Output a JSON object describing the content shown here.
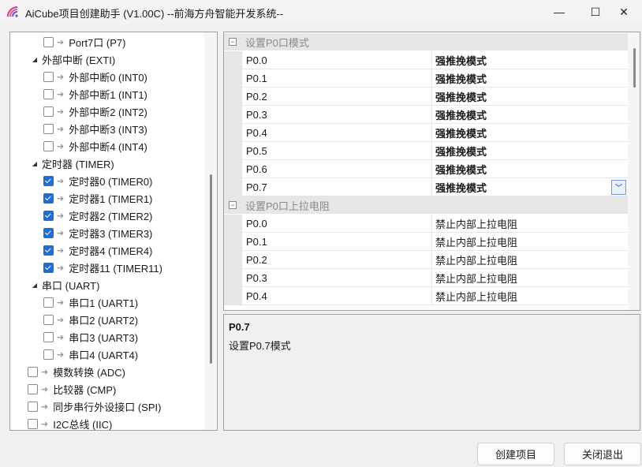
{
  "window": {
    "title": "AiCube项目创建助手 (V1.00C) --前海方舟智能开发系统--",
    "app_icon": "aicube-logo-icon",
    "minimize_glyph": "—",
    "maximize_glyph": "☐",
    "close_glyph": "✕"
  },
  "tree": {
    "items": [
      {
        "label": "Port7口 (P7)",
        "level": 2,
        "checked": false,
        "type": "leaf"
      },
      {
        "label": "外部中断 (EXTI)",
        "level": 1,
        "type": "group",
        "expanded": true
      },
      {
        "label": "外部中断0 (INT0)",
        "level": 2,
        "checked": false,
        "type": "leaf"
      },
      {
        "label": "外部中断1 (INT1)",
        "level": 2,
        "checked": false,
        "type": "leaf"
      },
      {
        "label": "外部中断2 (INT2)",
        "level": 2,
        "checked": false,
        "type": "leaf"
      },
      {
        "label": "外部中断3 (INT3)",
        "level": 2,
        "checked": false,
        "type": "leaf"
      },
      {
        "label": "外部中断4 (INT4)",
        "level": 2,
        "checked": false,
        "type": "leaf"
      },
      {
        "label": "定时器 (TIMER)",
        "level": 1,
        "type": "group",
        "expanded": true
      },
      {
        "label": "定时器0 (TIMER0)",
        "level": 2,
        "checked": true,
        "type": "leaf"
      },
      {
        "label": "定时器1 (TIMER1)",
        "level": 2,
        "checked": true,
        "type": "leaf"
      },
      {
        "label": "定时器2 (TIMER2)",
        "level": 2,
        "checked": true,
        "type": "leaf"
      },
      {
        "label": "定时器3 (TIMER3)",
        "level": 2,
        "checked": true,
        "type": "leaf"
      },
      {
        "label": "定时器4 (TIMER4)",
        "level": 2,
        "checked": true,
        "type": "leaf"
      },
      {
        "label": "定时器11 (TIMER11)",
        "level": 2,
        "checked": true,
        "type": "leaf"
      },
      {
        "label": "串口 (UART)",
        "level": 1,
        "type": "group",
        "expanded": true
      },
      {
        "label": "串口1 (UART1)",
        "level": 2,
        "checked": false,
        "type": "leaf"
      },
      {
        "label": "串口2 (UART2)",
        "level": 2,
        "checked": false,
        "type": "leaf"
      },
      {
        "label": "串口3 (UART3)",
        "level": 2,
        "checked": false,
        "type": "leaf"
      },
      {
        "label": "串口4 (UART4)",
        "level": 2,
        "checked": false,
        "type": "leaf"
      },
      {
        "label": "模数转换 (ADC)",
        "level": 0,
        "checked": false,
        "type": "leaf"
      },
      {
        "label": "比较器 (CMP)",
        "level": 0,
        "checked": false,
        "type": "leaf"
      },
      {
        "label": "同步串行外设接口 (SPI)",
        "level": 0,
        "checked": false,
        "type": "leaf"
      },
      {
        "label": "I2C总线 (IIC)",
        "level": 0,
        "checked": false,
        "type": "leaf"
      }
    ]
  },
  "grid": {
    "sections": [
      {
        "title": "设置P0口模式",
        "rows": [
          {
            "name": "P0.0",
            "value": "强推挽模式"
          },
          {
            "name": "P0.1",
            "value": "强推挽模式"
          },
          {
            "name": "P0.2",
            "value": "强推挽模式"
          },
          {
            "name": "P0.3",
            "value": "强推挽模式"
          },
          {
            "name": "P0.4",
            "value": "强推挽模式"
          },
          {
            "name": "P0.5",
            "value": "强推挽模式"
          },
          {
            "name": "P0.6",
            "value": "强推挽模式"
          },
          {
            "name": "P0.7",
            "value": "强推挽模式",
            "selected": true
          }
        ]
      },
      {
        "title": "设置P0口上拉电阻",
        "rows": [
          {
            "name": "P0.0",
            "value": "禁止内部上拉电阻"
          },
          {
            "name": "P0.1",
            "value": "禁止内部上拉电阻"
          },
          {
            "name": "P0.2",
            "value": "禁止内部上拉电阻"
          },
          {
            "name": "P0.3",
            "value": "禁止内部上拉电阻"
          },
          {
            "name": "P0.4",
            "value": "禁止内部上拉电阻"
          }
        ]
      }
    ]
  },
  "description": {
    "title": "P0.7",
    "text": "设置P0.7模式"
  },
  "buttons": {
    "create": "创建项目",
    "exit": "关闭退出"
  },
  "colors": {
    "accent": "#1f6fd0",
    "category_bg": "#e6e6e6"
  }
}
